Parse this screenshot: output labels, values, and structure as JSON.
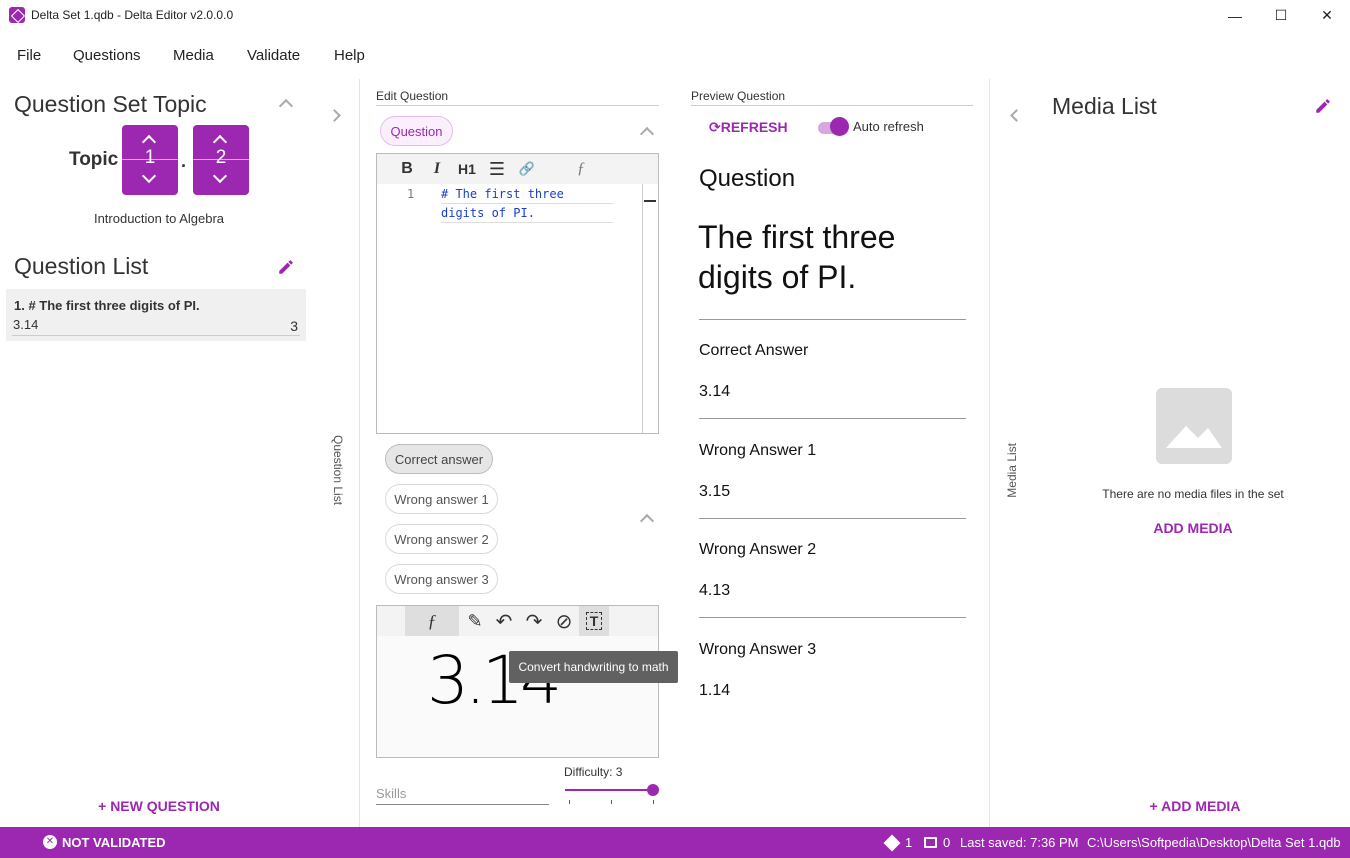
{
  "window": {
    "title": "Delta Set 1.qdb - Delta Editor v2.0.0.0",
    "minimize": "—",
    "maximize": "☐",
    "close": "✕"
  },
  "menu": [
    "File",
    "Questions",
    "Media",
    "Validate",
    "Help"
  ],
  "topic": {
    "heading": "Question Set Topic",
    "label": "Topic",
    "major": "1",
    "separator": ".",
    "minor": "2",
    "name": "Introduction to Algebra"
  },
  "question_list": {
    "heading": "Question List",
    "rail_label": "Question List",
    "items": [
      {
        "title": "1. # The first three digits of PI.",
        "answer": "3.14",
        "difficulty": "3"
      }
    ],
    "new_button": "+ NEW QUESTION"
  },
  "edit": {
    "heading": "Edit Question",
    "question_chip": "Question",
    "toolbar": {
      "bold": "B",
      "italic": "I",
      "h1": "H1",
      "list": "☰",
      "link": "🔗",
      "formula": "ƒ"
    },
    "line_number": "1",
    "code_line1": "# The first three",
    "code_line2": "digits of PI.",
    "answer_chips": [
      "Correct answer",
      "Wrong answer 1",
      "Wrong answer 2",
      "Wrong answer 3"
    ],
    "ink_toolbar": {
      "formula": "ƒ",
      "pen": "✎",
      "undo": "↶",
      "redo": "↷",
      "clear": "⊘",
      "convert": "T"
    },
    "tooltip": "Convert handwriting to math",
    "handwriting": "3.14",
    "skills_placeholder": "Skills",
    "difficulty_label": "Difficulty: 3",
    "difficulty_value": 3,
    "difficulty_max": 3
  },
  "preview": {
    "heading": "Preview Question",
    "refresh": "REFRESH",
    "auto_refresh": "Auto refresh",
    "auto_refresh_on": true,
    "question_label": "Question",
    "question_text_line1": "The first three",
    "question_text_line2": "digits of PI.",
    "answers": [
      {
        "label": "Correct Answer",
        "value": "3.14"
      },
      {
        "label": "Wrong Answer 1",
        "value": "3.15"
      },
      {
        "label": "Wrong Answer 2",
        "value": "4.13"
      },
      {
        "label": "Wrong Answer 3",
        "value": "1.14"
      }
    ]
  },
  "media": {
    "heading": "Media List",
    "rail_label": "Media List",
    "empty_text": "There are no media files in the set",
    "add_link": "ADD MEDIA",
    "add_button": "+ ADD MEDIA"
  },
  "status": {
    "validation": "NOT VALIDATED",
    "question_count": "1",
    "media_count": "0",
    "last_saved": "Last saved: 7:36 PM",
    "path": "C:\\Users\\Softpedia\\Desktop\\Delta Set 1.qdb"
  },
  "colors": {
    "accent": "#9c27b0"
  }
}
